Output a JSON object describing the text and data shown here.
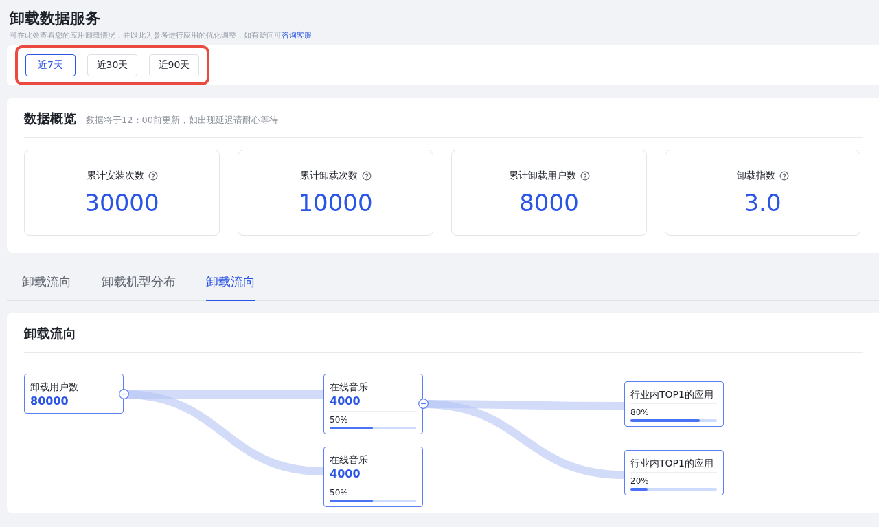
{
  "title": "卸载数据服务",
  "subtitle": {
    "text": "可在此处查看您的应用卸载情况，并以此为参考进行应用的优化调整，如有疑问可",
    "link": "咨询客服"
  },
  "date_filters": [
    {
      "label": "近7天",
      "selected": true
    },
    {
      "label": "近30天",
      "selected": false
    },
    {
      "label": "近90天",
      "selected": false
    }
  ],
  "overview": {
    "title": "数据概览",
    "note": "数据将于12：00前更新，如出现延迟请耐心等待",
    "stats": [
      {
        "label": "累计安装次数",
        "value": "30000"
      },
      {
        "label": "累计卸载次数",
        "value": "10000"
      },
      {
        "label": "累计卸载用户数",
        "value": "8000"
      },
      {
        "label": "卸载指数",
        "value": "3.0"
      }
    ]
  },
  "tabs": [
    {
      "label": "卸载流向",
      "selected": false
    },
    {
      "label": "卸载机型分布",
      "selected": false
    },
    {
      "label": "卸载流向",
      "selected": true
    }
  ],
  "flow": {
    "title": "卸载流向",
    "root": {
      "label": "卸载用户数",
      "value": "80000",
      "expanded": true,
      "children": [
        {
          "label": "在线音乐",
          "value": "4000",
          "share": "50%",
          "level": 0.5,
          "expanded": true,
          "children": [
            {
              "label": "行业内TOP1的应用",
              "share": "80%",
              "level": 0.8
            },
            {
              "label": "行业内TOP1的应用",
              "share": "20%",
              "level": 0.2
            }
          ]
        },
        {
          "label": "在线音乐",
          "value": "4000",
          "share": "50%",
          "level": 0.5
        }
      ]
    }
  }
}
